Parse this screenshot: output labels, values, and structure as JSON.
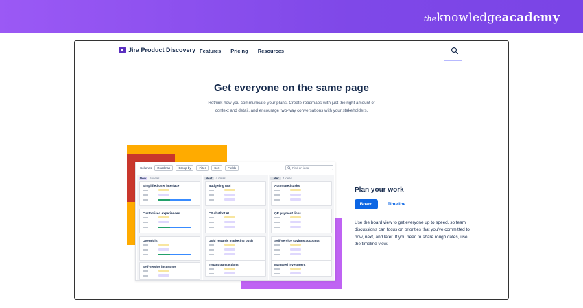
{
  "brand": {
    "the": "the",
    "knowledge": "knowledge",
    "academy": "academy"
  },
  "nav": {
    "logo_text": "Jira Product Discovery",
    "links": [
      "Features",
      "Pricing",
      "Resources"
    ]
  },
  "hero": {
    "headline": "Get everyone on the same page",
    "subtext": "Rethink how you communicate your plans. Create roadmaps with just the right amount of context and detail, and encourage two-way conversations with your stakeholders."
  },
  "board": {
    "toolbar": {
      "columns": "Columns",
      "roadmap": "Roadmap",
      "group_by": "Group by",
      "filter": "Filter",
      "sort": "Sort",
      "fields": "Fields",
      "search_placeholder": "Find an idea"
    },
    "columns": [
      {
        "name": "Now",
        "count": "5 ideas",
        "color": "#dfd8fd",
        "cards": [
          {
            "title": "Simplified user interface"
          },
          {
            "title": "Customised experiences"
          },
          {
            "title": "Overnight"
          },
          {
            "title": "Self-service insurance"
          }
        ]
      },
      {
        "name": "Next",
        "count": "4 ideas",
        "color": "#dcdfe4",
        "cards": [
          {
            "title": "Budgeting tool"
          },
          {
            "title": "CS chatbot AI"
          },
          {
            "title": "Gold rewards marketing push"
          },
          {
            "title": "Instant transactions"
          }
        ]
      },
      {
        "name": "Later",
        "count": "4 ideas",
        "color": "#dcdfe4",
        "cards": [
          {
            "title": "Automated tasks"
          },
          {
            "title": "QR payment links"
          },
          {
            "title": "Self-service savings accounts"
          },
          {
            "title": "Managed investment"
          }
        ]
      }
    ]
  },
  "side": {
    "title": "Plan your work",
    "tab_board": "Board",
    "tab_timeline": "Timeline",
    "description": "Use the board view to get everyone up to speed, so team discussions can focus on priorities that you've committed to now, next, and later. If you need to share rough dates, use the timeline view."
  },
  "colors": {
    "brand_purple": "#8450ed",
    "accent_blue": "#0c66e4",
    "deco_orange": "#ffab00",
    "deco_red": "#c9372c",
    "deco_purple": "#bf63f3",
    "chip_yellow": "#f8e6a0",
    "chip_lavender": "#dfd8fd"
  }
}
